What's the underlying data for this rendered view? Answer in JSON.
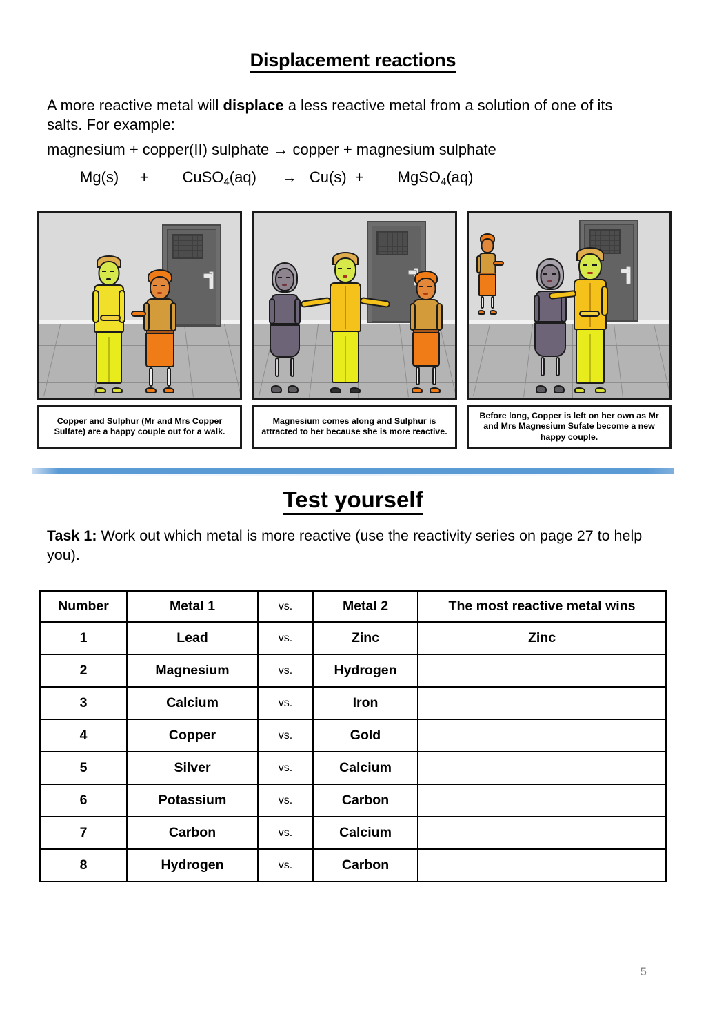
{
  "document": {
    "title": "Displacement reactions",
    "intro_before_bold": "A more reactive metal will ",
    "intro_bold": "displace",
    "intro_after_bold": " a less reactive metal from a solution of one of its salts. For example:",
    "equation_word": "magnesium + copper(II) sulphate → copper + magnesium sulphate",
    "equation_symbols_parts": {
      "p1": "Mg(s)     +        CuSO",
      "sub1": "4",
      "p2": "(aq)      →   Cu(s)  +        MgSO",
      "sub2": "4",
      "p3": "(aq)"
    },
    "page_number": "5"
  },
  "comic": {
    "panels": [
      {
        "caption": "Copper and Sulphur (Mr and Mrs Copper Sulfate) are a happy couple out for a walk.",
        "characters": "yellow-male-sulphur, orange-female-copper"
      },
      {
        "caption": "Magnesium comes along and Sulphur is attracted to her because she is more reactive.",
        "characters": "grey-female-magnesium, yellow-male-sulphur, orange-female-copper"
      },
      {
        "caption": "Before long, Copper is left on her own as Mr and Mrs Magnesium Sufate become a new happy couple.",
        "characters": "orange-female-copper-background, grey-female-magnesium, yellow-male-sulphur"
      }
    ]
  },
  "test_section": {
    "heading": "Test yourself",
    "task_label": "Task 1:",
    "task_text": " Work out which metal is more reactive (use the reactivity series on page 27 to help you)."
  },
  "table": {
    "headers": [
      "Number",
      "Metal 1",
      "vs.",
      "Metal 2",
      "The most reactive metal wins"
    ],
    "rows": [
      {
        "number": "1",
        "metal1": "Lead",
        "vs": "vs.",
        "metal2": "Zinc",
        "winner": "Zinc"
      },
      {
        "number": "2",
        "metal1": "Magnesium",
        "vs": "vs.",
        "metal2": "Hydrogen",
        "winner": ""
      },
      {
        "number": "3",
        "metal1": "Calcium",
        "vs": "vs.",
        "metal2": "Iron",
        "winner": ""
      },
      {
        "number": "4",
        "metal1": "Copper",
        "vs": "vs.",
        "metal2": "Gold",
        "winner": ""
      },
      {
        "number": "5",
        "metal1": "Silver",
        "vs": "vs.",
        "metal2": "Calcium",
        "winner": ""
      },
      {
        "number": "6",
        "metal1": "Potassium",
        "vs": "vs.",
        "metal2": "Carbon",
        "winner": ""
      },
      {
        "number": "7",
        "metal1": "Carbon",
        "vs": "vs.",
        "metal2": "Calcium",
        "winner": ""
      },
      {
        "number": "8",
        "metal1": "Hydrogen",
        "vs": "vs.",
        "metal2": "Carbon",
        "winner": ""
      }
    ]
  },
  "colors": {
    "divider_blue": "#5b9bd5",
    "sulphur_yellow": "#ecec12",
    "sulphur_shirt": "#f5c21b",
    "copper_orange": "#ef7c17",
    "copper_top": "#d49b3a",
    "magnesium_grey": "#6d6577",
    "wall_grey": "#dadada",
    "floor_grey": "#b4b4b4",
    "door_grey": "#636363",
    "page_number_grey": "#808080"
  }
}
